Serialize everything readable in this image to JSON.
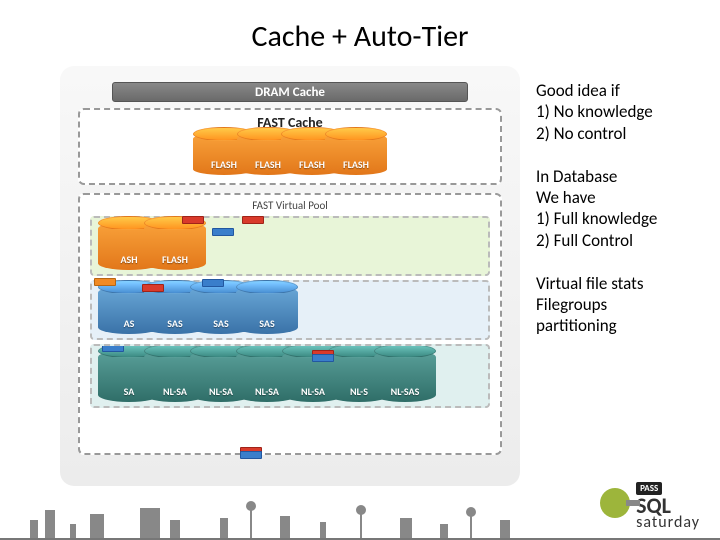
{
  "title": "Cache + Auto-Tier",
  "diagram": {
    "dram_label": "DRAM Cache",
    "fast_cache_label": "FAST Cache",
    "fast_cache_disks": [
      {
        "label": "FLASH"
      },
      {
        "label": "FLASH"
      },
      {
        "label": "FLASH"
      },
      {
        "label": "FLASH"
      }
    ],
    "fast_pool_label": "FAST Virtual Pool",
    "tiers": [
      {
        "name": "flash-tier",
        "style": "green",
        "disk_class": "orange md",
        "disks": [
          {
            "label": "ASH"
          },
          {
            "label": "FLASH"
          }
        ]
      },
      {
        "name": "sas-tier",
        "style": "blue",
        "disk_class": "sas md",
        "disks": [
          {
            "label": "AS"
          },
          {
            "label": "SAS"
          },
          {
            "label": "SAS"
          },
          {
            "label": "SAS"
          }
        ]
      },
      {
        "name": "nlsas-tier",
        "style": "teal",
        "disk_class": "nlsas lg",
        "disks": [
          {
            "label": "SA"
          },
          {
            "label": "NL-SA"
          },
          {
            "label": "NL-SA"
          },
          {
            "label": "NL-SA"
          },
          {
            "label": "NL-SA"
          },
          {
            "label": "NL-S"
          },
          {
            "label": "NL-SAS"
          }
        ]
      }
    ]
  },
  "notes": {
    "block1": {
      "line1": "Good idea if",
      "line2": "1) No knowledge",
      "line3": "2) No control"
    },
    "block2": {
      "line1": "In Database",
      "line2": "We have",
      "line3": "1)   Full knowledge",
      "line4": "2)   Full Control"
    },
    "block3": {
      "line1": "Virtual file stats",
      "line2": "Filegroups",
      "line3": "partitioning"
    }
  },
  "logo": {
    "pass": "PASS",
    "line1": "SQL",
    "line2": "saturday"
  }
}
